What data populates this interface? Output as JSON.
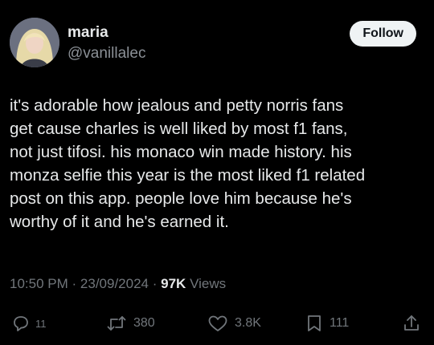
{
  "author": {
    "display_name": "maria",
    "handle": "@vanillalec",
    "follow_label": "Follow"
  },
  "tweet": {
    "text": "it's adorable how jealous and petty norris fans\nget cause charles is well liked by most f1 fans,\nnot just tifosi. his monaco win made history. his\nmonza selfie this year is the most liked f1 related\npost on this app. people love him because he's\nworthy of it and he's earned it."
  },
  "meta": {
    "time": "10:50 PM",
    "separator": "·",
    "date": "23/09/2024",
    "views_count": "97K",
    "views_label": "Views"
  },
  "actions": {
    "replies": "11",
    "reposts": "380",
    "likes": "3.8K",
    "bookmarks": "111"
  },
  "icons": [
    "reply-icon",
    "repost-icon",
    "like-icon",
    "bookmark-icon",
    "share-icon"
  ],
  "colors": {
    "background": "#000000",
    "text": "#e7e9ea",
    "secondary": "#71767b",
    "follow_bg": "#eff3f4"
  }
}
